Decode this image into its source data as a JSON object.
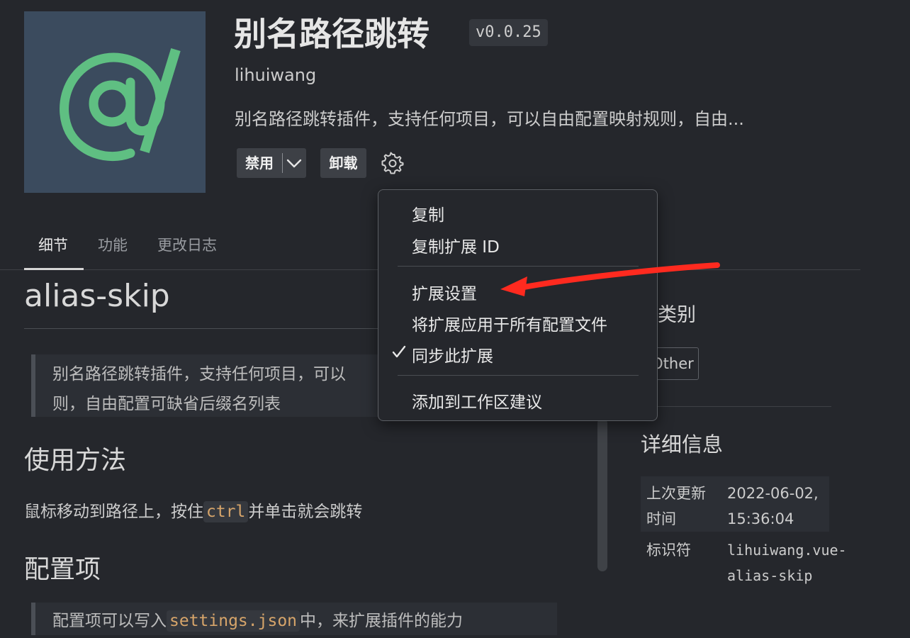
{
  "header": {
    "title": "别名路径跳转",
    "version": "v0.0.25",
    "publisher": "lihuiwang",
    "description": "别名路径跳转插件，支持任何项目，可以自由配置映射规则，自由...",
    "disable_label": "禁用",
    "uninstall_label": "卸载"
  },
  "tabs": [
    {
      "label": "细节"
    },
    {
      "label": "功能"
    },
    {
      "label": "更改日志"
    }
  ],
  "readme": {
    "title": "alias-skip",
    "quote1_line1": "别名路径跳转插件，支持任何项目，可以",
    "quote1_line2": "则，自由配置可缺省后缀名列表",
    "usage_heading": "使用方法",
    "usage_before": "鼠标移动到路径上，按住",
    "usage_code": "ctrl",
    "usage_after": "并单击就会跳转",
    "config_heading": "配置项",
    "config_before": "配置项可以写入",
    "config_code": "settings.json",
    "config_after": "中，来扩展插件的能力"
  },
  "sidebar": {
    "categories_title": "类别",
    "category_tag": "Other",
    "details_title": "详细信息",
    "last_updated_label_1": "上次更新",
    "last_updated_label_2": "时间",
    "last_updated_value_1": "2022-06-02,",
    "last_updated_value_2": "15:36:04",
    "identifier_label": "标识符",
    "identifier_value_1": "lihuiwang.vue-",
    "identifier_value_2": "alias-skip"
  },
  "context_menu": {
    "items": [
      {
        "label": "复制"
      },
      {
        "label": "复制扩展 ID"
      },
      {
        "label": "扩展设置"
      },
      {
        "label": "将扩展应用于所有配置文件"
      },
      {
        "label": "同步此扩展",
        "checked": true
      },
      {
        "label": "添加到工作区建议"
      }
    ]
  },
  "colors": {
    "background": "#25272c",
    "logo_bg": "#3b4b5e",
    "logo_fg": "#5fbf82",
    "arrow": "#ff2a1f"
  }
}
